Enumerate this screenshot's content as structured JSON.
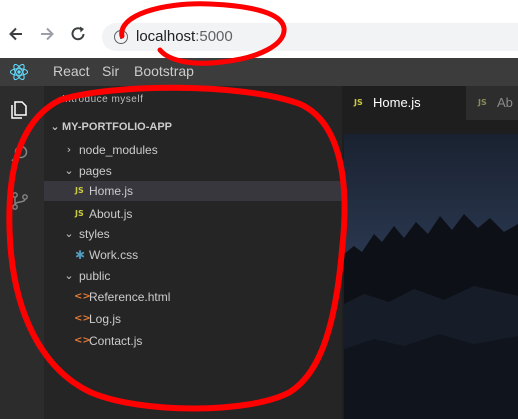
{
  "browser": {
    "url_host": "localhost",
    "url_port": ":5000",
    "back_icon": "arrow-left-icon",
    "forward_icon": "arrow-right-icon",
    "reload_icon": "reload-icon",
    "info_glyph": "i"
  },
  "menubar": {
    "logo_icon": "react-logo-icon",
    "items": [
      "React",
      "Sir",
      "Bootstrap"
    ]
  },
  "activity_bar": {
    "icons": [
      "files-icon",
      "search-icon",
      "source-control-icon"
    ]
  },
  "sidebar": {
    "partial_header": "Introduce myself",
    "root": "MY-PORTFOLIO-APP",
    "tree": [
      {
        "label": "node_modules",
        "kind": "folder",
        "expanded": false
      },
      {
        "label": "pages",
        "kind": "folder",
        "expanded": true
      },
      {
        "label": "Home.js",
        "kind": "js",
        "selected": true
      },
      {
        "label": "About.js",
        "kind": "js"
      },
      {
        "label": "styles",
        "kind": "folder",
        "expanded": true
      },
      {
        "label": "Work.css",
        "kind": "css"
      },
      {
        "label": "public",
        "kind": "folder",
        "expanded": true
      },
      {
        "label": "Reference.html",
        "kind": "html"
      },
      {
        "label": "Log.js",
        "kind": "html"
      },
      {
        "label": "Contact.js",
        "kind": "html"
      }
    ],
    "badges": {
      "js": "JS",
      "css": "✱",
      "html": "<>"
    }
  },
  "editor": {
    "tabs": [
      {
        "label": "Home.js",
        "badge": "JS",
        "active": true
      },
      {
        "label": "Ab",
        "badge": "JS",
        "active": false
      }
    ]
  },
  "colors": {
    "annotation": "#ff0000",
    "accent_js": "#cbcb41",
    "accent_css": "#519aba",
    "accent_html": "#e37933",
    "react": "#61dafb"
  }
}
